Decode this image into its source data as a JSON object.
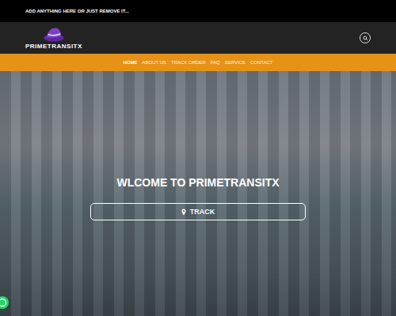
{
  "topbar": {
    "text": "ADD ANYTHING HERE OR JUST REMOVE IT..."
  },
  "logo": {
    "text": "PRIMETRANSITX"
  },
  "nav": [
    {
      "label": "HOME",
      "selected": true
    },
    {
      "label": "ABOUT US",
      "selected": false
    },
    {
      "label": "TRACK ORDER",
      "selected": false
    },
    {
      "label": "FAQ",
      "selected": false
    },
    {
      "label": "SERVICE",
      "selected": false
    },
    {
      "label": "CONTACT",
      "selected": false
    }
  ],
  "hero": {
    "title": "WLCOME TO PRIMETRANSITX",
    "button": "TRACK"
  }
}
